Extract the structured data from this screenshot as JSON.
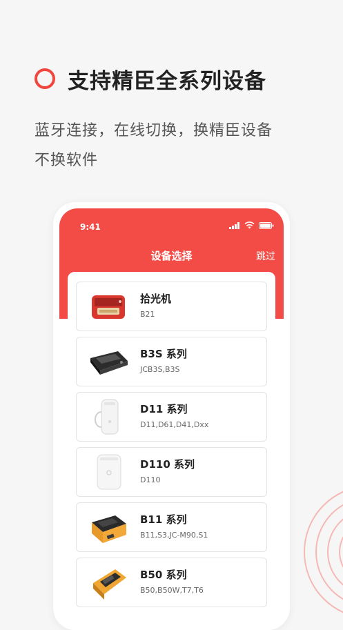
{
  "hero": {
    "title": "支持精臣全系列设备",
    "subtitle_line1": "蓝牙连接，在线切换，换精臣设备",
    "subtitle_line2": "不换软件"
  },
  "colors": {
    "accent": "#f0463e",
    "header": "#f34b45"
  },
  "phone": {
    "status_time": "9:41",
    "nav_title": "设备选择",
    "skip_label": "跳过",
    "devices": [
      {
        "name": "拾光机",
        "models": "B21",
        "icon": "red-retro-printer-icon"
      },
      {
        "name": "B3S 系列",
        "models": "JCB3S,B3S",
        "icon": "black-portable-printer-icon"
      },
      {
        "name": "D11 系列",
        "models": "D11,D61,D41,Dxx",
        "icon": "white-handheld-label-printer-icon"
      },
      {
        "name": "D110 系列",
        "models": "D110",
        "icon": "white-compact-printer-icon"
      },
      {
        "name": "B11 系列",
        "models": "B11,S3,JC-M90,S1",
        "icon": "orange-rugged-printer-icon"
      },
      {
        "name": "B50 系列",
        "models": "B50,B50W,T7,T6",
        "icon": "orange-industrial-printer-icon"
      }
    ]
  }
}
